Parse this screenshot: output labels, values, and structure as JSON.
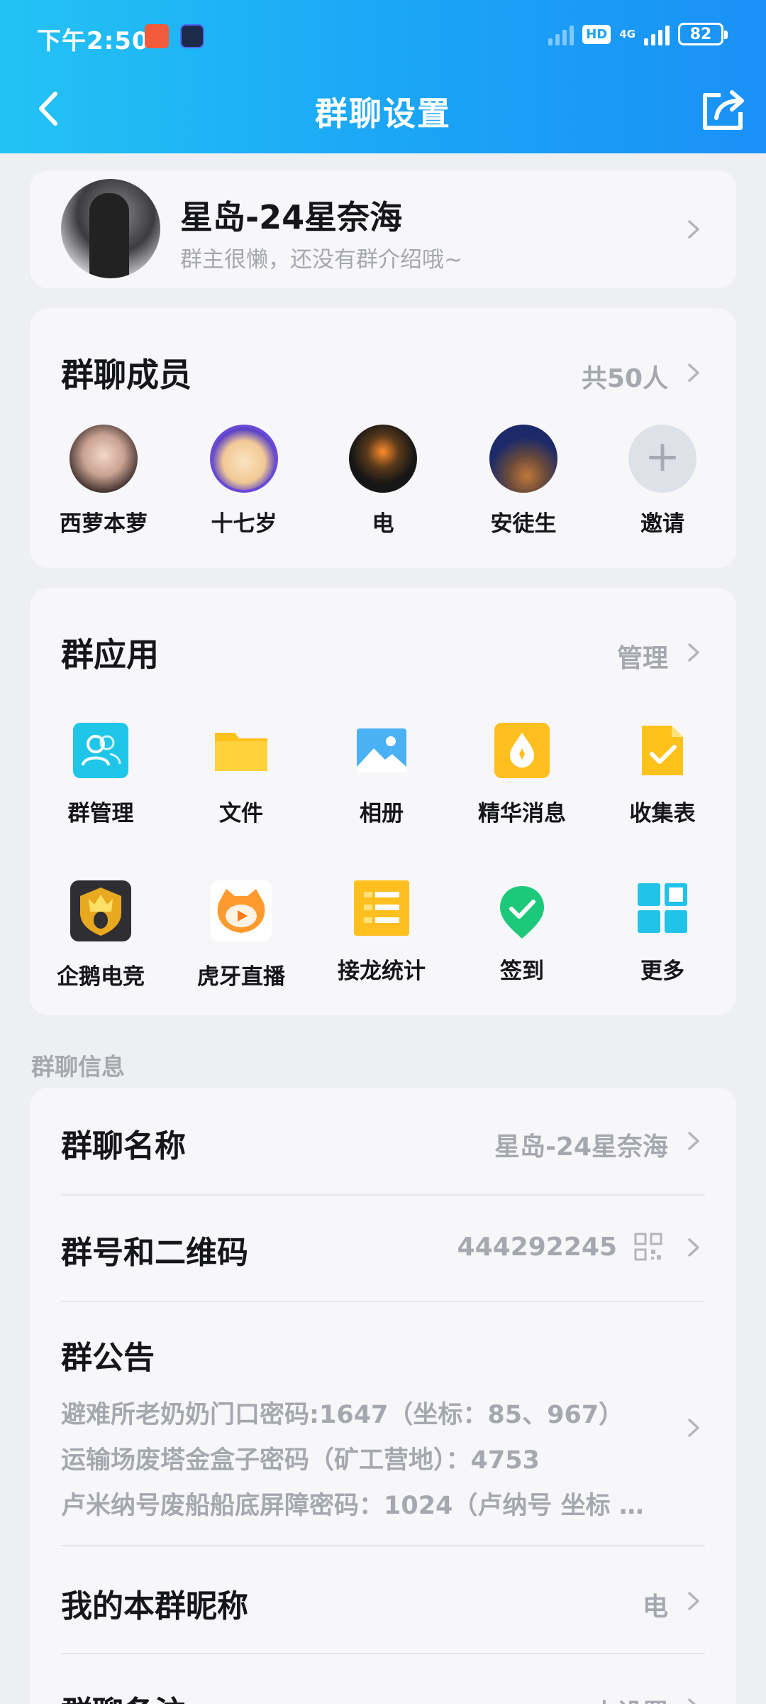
{
  "status_bar": {
    "time": "下午2:50",
    "hd": "HD",
    "network": "4G",
    "battery": "82"
  },
  "nav": {
    "title": "群聊设置"
  },
  "group": {
    "name": "星岛-24星奈海",
    "description": "群主很懒，还没有群介绍哦~"
  },
  "members": {
    "title": "群聊成员",
    "count_label": "共50人",
    "items": [
      {
        "name": "西萝本萝"
      },
      {
        "name": "十七岁"
      },
      {
        "name": "电"
      },
      {
        "name": "安徒生"
      },
      {
        "name": "邀请",
        "icon": "plus-icon"
      }
    ]
  },
  "apps": {
    "title": "群应用",
    "manage_label": "管理",
    "items": [
      {
        "label": "群管理",
        "icon": "group-manage-icon",
        "color": "#1fc6e8"
      },
      {
        "label": "文件",
        "icon": "folder-icon",
        "color": "#ffc21a"
      },
      {
        "label": "相册",
        "icon": "photo-album-icon",
        "color": "#4ab1f5"
      },
      {
        "label": "精华消息",
        "icon": "essence-icon",
        "color": "#ffbf1f"
      },
      {
        "label": "收集表",
        "icon": "form-check-icon",
        "color": "#ffc21a"
      },
      {
        "label": "企鹅电竞",
        "icon": "penguin-esports-icon",
        "color": "#2f2f33"
      },
      {
        "label": "虎牙直播",
        "icon": "huya-live-icon",
        "color": "#ff9a2e"
      },
      {
        "label": "接龙统计",
        "icon": "relay-list-icon",
        "color": "#ffbf1f"
      },
      {
        "label": "签到",
        "icon": "checkin-icon",
        "color": "#1ec87a"
      },
      {
        "label": "更多",
        "icon": "more-grid-icon",
        "color": "#22c3e8"
      }
    ]
  },
  "info": {
    "section_label": "群聊信息",
    "group_name_label": "群聊名称",
    "group_name_value": "星岛-24星奈海",
    "group_number_label": "群号和二维码",
    "group_number_value": "444292245",
    "notice_label": "群公告",
    "notice_lines": [
      "避难所老奶奶门口密码:1647（坐标：85、967）",
      "运输场废塔金盒子密码（矿工营地）：4753",
      "卢米纳号废船船底屏障密码：1024（卢纳号 坐标 …"
    ],
    "nickname_label": "我的本群昵称",
    "nickname_value": "电",
    "remark_label": "群聊备注",
    "remark_value": "未设置"
  }
}
